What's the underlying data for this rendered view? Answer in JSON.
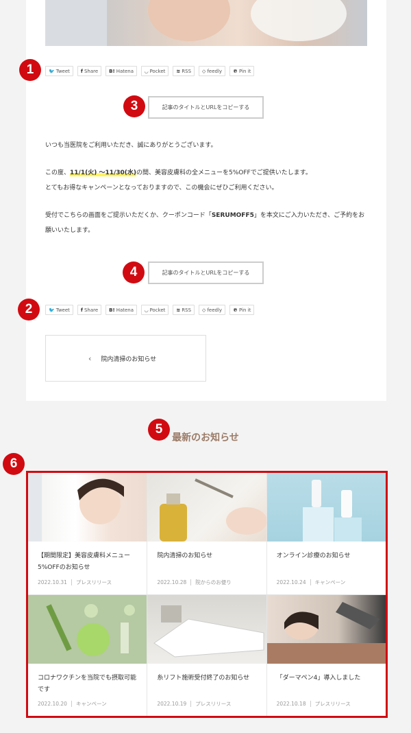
{
  "share_buttons": [
    {
      "icon": "twitter-icon",
      "glyph": "🐦",
      "label": "Tweet"
    },
    {
      "icon": "facebook-icon",
      "glyph": "f",
      "label": "Share"
    },
    {
      "icon": "hatena-icon",
      "glyph": "B!",
      "label": "Hatena"
    },
    {
      "icon": "pocket-icon",
      "glyph": "◡",
      "label": "Pocket"
    },
    {
      "icon": "rss-icon",
      "glyph": "≋",
      "label": "RSS"
    },
    {
      "icon": "feedly-icon",
      "glyph": "◇",
      "label": "feedly"
    },
    {
      "icon": "pinterest-icon",
      "glyph": "℗",
      "label": "Pin it"
    }
  ],
  "badges": {
    "b1": "1",
    "b2": "2",
    "b3": "3",
    "b4": "4",
    "b5": "5",
    "b6": "6"
  },
  "copy_button": {
    "label": "記事のタイトルとURLをコピーする"
  },
  "article": {
    "p1": "いつも当医院をご利用いただき、誠にありがとうございます。",
    "p2_pre": "この度、",
    "p2_hl": "11/1(火) 〜11/30(水)",
    "p2_post": "の間、美容皮膚科の全メニューを5%OFFでご提供いたします。",
    "p3": "とてもお得なキャンペーンとなっておりますので、この機会にぜひご利用ください。",
    "p4_pre": "受付でこちらの画面をご提示いただくか、クーポンコード「",
    "p4_code": "SERUMOFF5",
    "p4_post": "」を本文にご入力いただき、ご予約をお",
    "p5": "願いいたします。"
  },
  "prev_post": {
    "title": "院内清掃のお知らせ"
  },
  "section_title": "最新のお知らせ",
  "cards": [
    {
      "title": "【期間限定】美容皮膚科メニュー5%OFFのお知らせ",
      "date": "2022.10.31",
      "category": "プレスリリース"
    },
    {
      "title": "院内清掃のお知らせ",
      "date": "2022.10.28",
      "category": "院からのお便り"
    },
    {
      "title": "オンライン診療のお知らせ",
      "date": "2022.10.24",
      "category": "キャンペーン"
    },
    {
      "title": "コロナワクチンを当院でも摂取可能です",
      "date": "2022.10.20",
      "category": "キャンペーン"
    },
    {
      "title": "糸リフト施術受付終了のお知らせ",
      "date": "2022.10.19",
      "category": "プレスリリース"
    },
    {
      "title": "「ダーマペン4」導入しました",
      "date": "2022.10.18",
      "category": "プレスリリース"
    }
  ],
  "colors": {
    "badge": "#d10a11",
    "highlight": "#fff35c",
    "section_title": "#9b7b67"
  }
}
